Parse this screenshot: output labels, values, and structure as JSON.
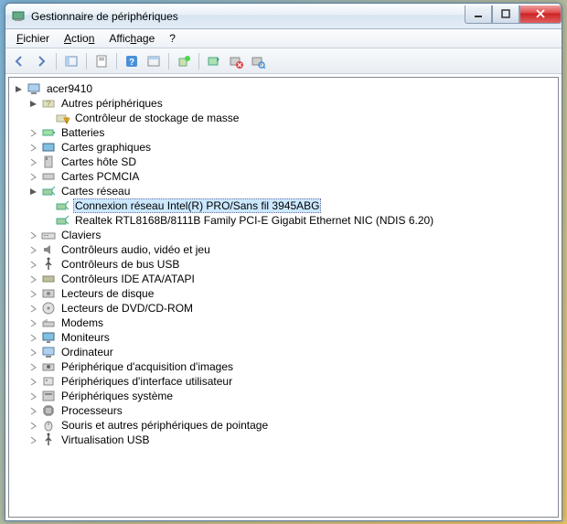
{
  "window": {
    "title": "Gestionnaire de périphériques"
  },
  "menu": {
    "file": "Fichier",
    "action": "Action",
    "view": "Affichage",
    "help": "?"
  },
  "toolbar_icons": {
    "back": "back-arrow",
    "forward": "forward-arrow",
    "show": "show-pane",
    "props": "properties",
    "help": "help",
    "view": "view-mode",
    "scan": "scan-hardware",
    "enable": "enable-device",
    "disable": "disable-device",
    "uninstall": "uninstall-device"
  },
  "tree": {
    "root": "acer9410",
    "other_devices": "Autres périphériques",
    "mass_storage": "Contrôleur de stockage de masse",
    "batteries": "Batteries",
    "display": "Cartes graphiques",
    "sd_host": "Cartes hôte SD",
    "pcmcia": "Cartes PCMCIA",
    "network": "Cartes réseau",
    "wifi": "Connexion réseau Intel(R) PRO/Sans fil 3945ABG",
    "ethernet": "Realtek RTL8168B/8111B Family PCI-E Gigabit Ethernet NIC (NDIS 6.20)",
    "keyboards": "Claviers",
    "sound": "Contrôleurs audio, vidéo et jeu",
    "usb": "Contrôleurs de bus USB",
    "ide": "Contrôleurs IDE ATA/ATAPI",
    "disk": "Lecteurs de disque",
    "dvd": "Lecteurs de DVD/CD-ROM",
    "modems": "Modems",
    "monitors": "Moniteurs",
    "computer": "Ordinateur",
    "imaging": "Périphérique d'acquisition d'images",
    "hid": "Périphériques d'interface utilisateur",
    "system": "Périphériques système",
    "processors": "Processeurs",
    "mice": "Souris et autres périphériques de pointage",
    "virt_usb": "Virtualisation USB"
  }
}
